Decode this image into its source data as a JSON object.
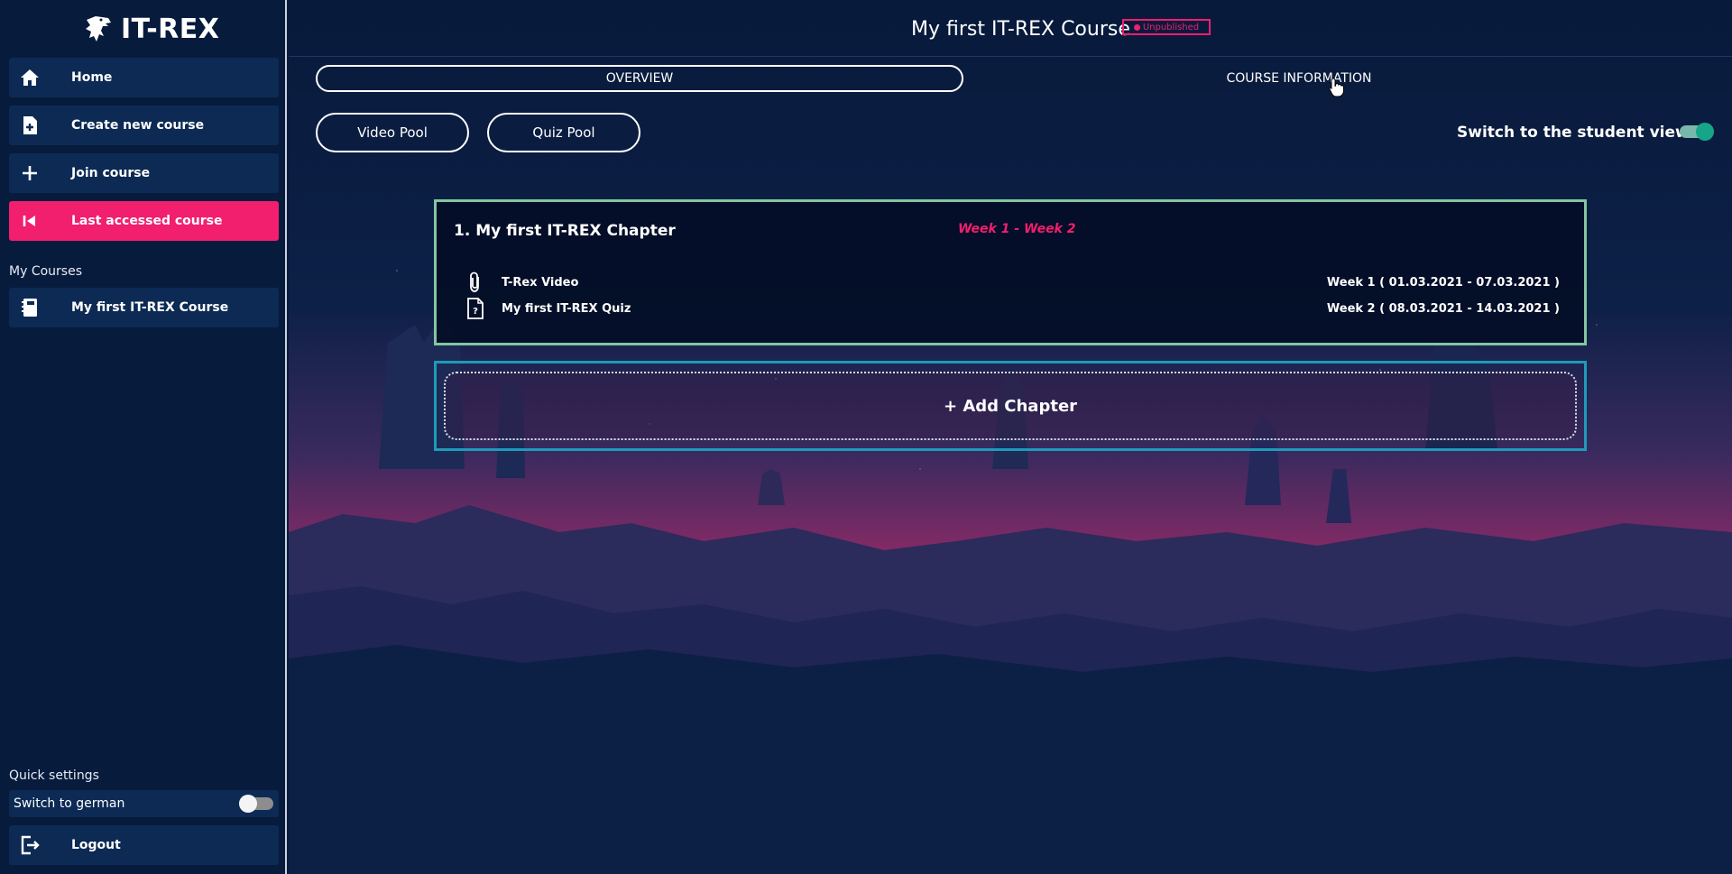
{
  "sidebar": {
    "brand": "IT-REX",
    "nav": [
      {
        "label": "Home",
        "icon": "home-icon"
      },
      {
        "label": "Create new course",
        "icon": "file-plus-icon"
      },
      {
        "label": "Join course",
        "icon": "plus-icon"
      },
      {
        "label": "Last accessed course",
        "icon": "skip-back-icon",
        "active": true
      }
    ],
    "my_courses_label": "My Courses",
    "courses": [
      {
        "label": "My first IT-REX Course",
        "icon": "notebook-icon"
      }
    ],
    "quick_settings_label": "Quick settings",
    "switch_german_label": "Switch to german",
    "switch_german_on": false,
    "logout_label": "Logout"
  },
  "header": {
    "course_title": "My first IT-REX Course",
    "status_badge": "Unpublished"
  },
  "tabs": {
    "overview": "OVERVIEW",
    "course_information": "COURSE INFORMATION"
  },
  "toolbar": {
    "video_pool": "Video Pool",
    "quiz_pool": "Quiz Pool",
    "student_view_label": "Switch to the student view",
    "student_view_on": true
  },
  "chapters": [
    {
      "title": "1. My first IT-REX Chapter",
      "weeks": "Week 1 - Week 2",
      "contents": [
        {
          "name": "T-Rex Video",
          "icon": "paperclip-icon",
          "date": "Week 1 ( 01.03.2021 - 07.03.2021 )"
        },
        {
          "name": "My first IT-REX Quiz",
          "icon": "quiz-file-icon",
          "date": "Week 2 ( 08.03.2021 - 14.03.2021 )"
        }
      ]
    }
  ],
  "add_chapter_label": "+ Add Chapter",
  "colors": {
    "accent_pink": "#f21e6e",
    "chapter_border": "#83c6a1",
    "add_chapter_border": "#1e9bb8",
    "toggle_on": "#17a589",
    "sidebar_item_bg": "#0c2a54",
    "page_bg": "#081a3b"
  }
}
